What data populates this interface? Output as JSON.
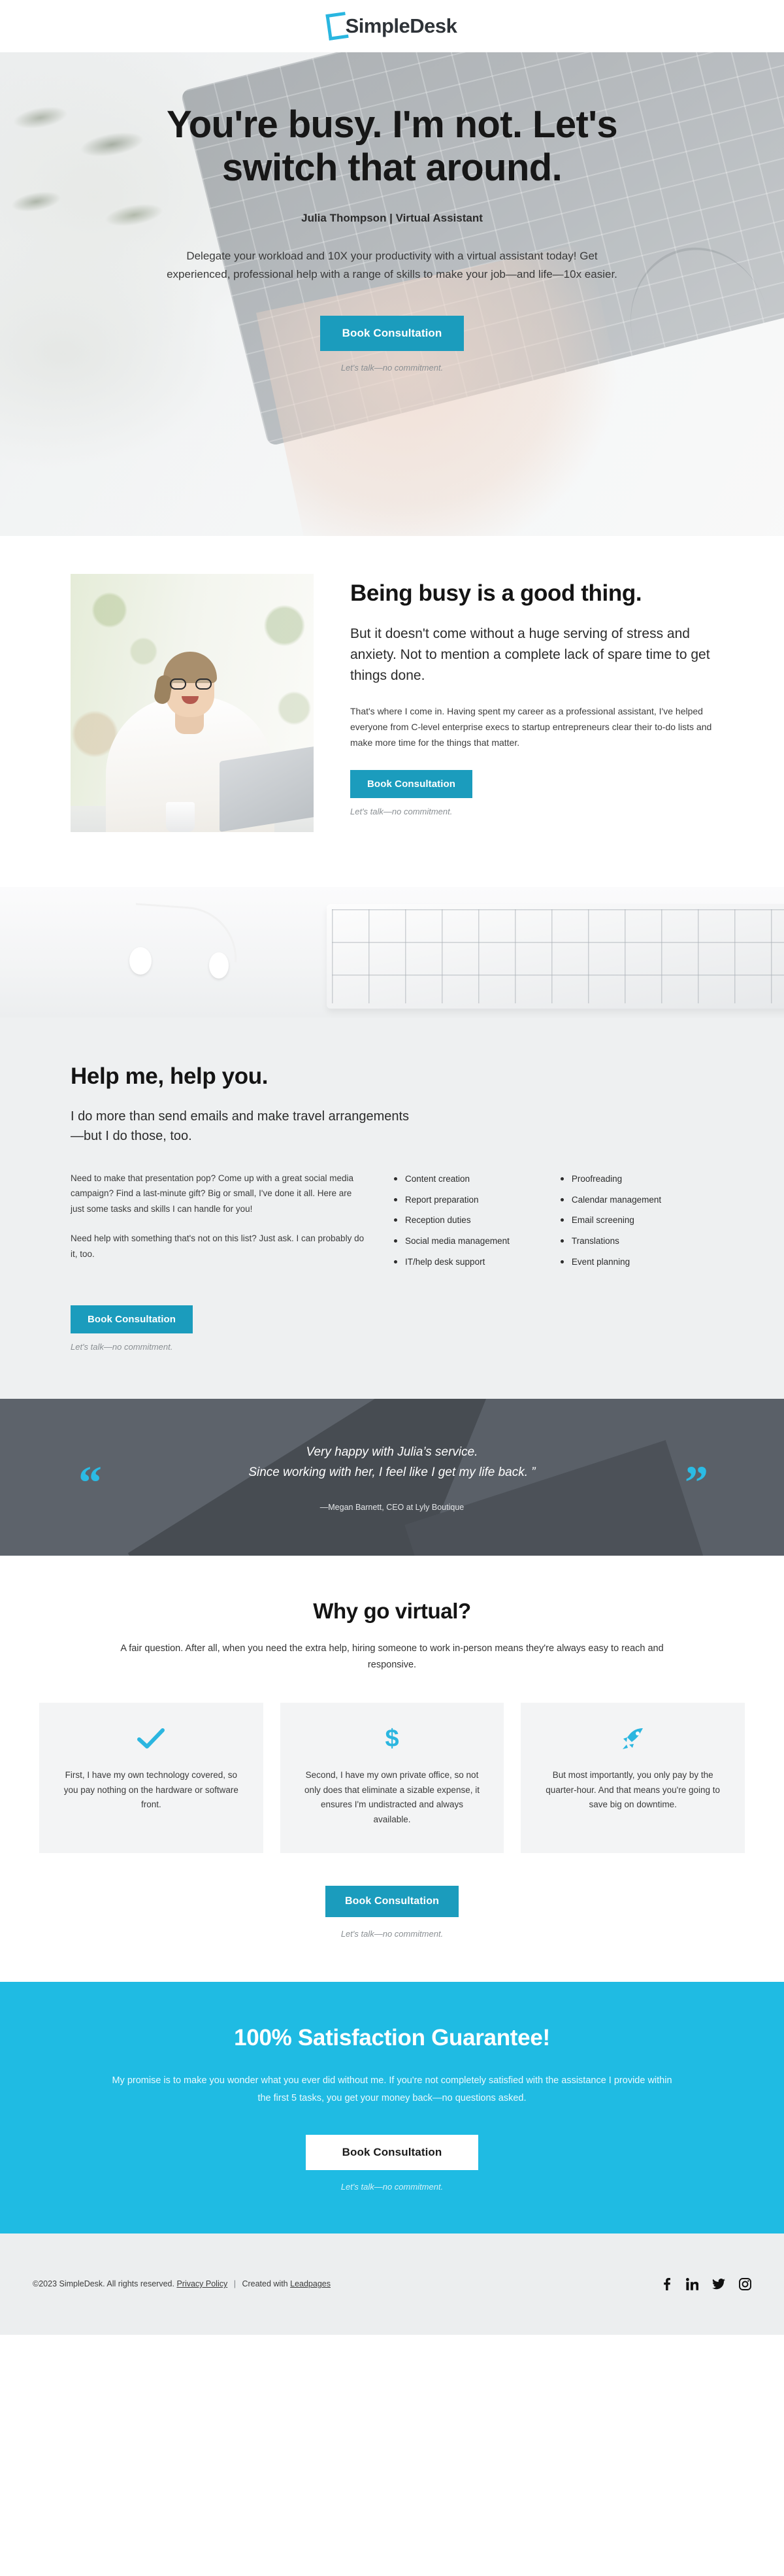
{
  "brand": {
    "name": "SimpleDesk",
    "accent_teal": "#1b9cbd",
    "accent_cyan": "#1fbbe3",
    "icon_mark": "bracket-mark"
  },
  "hero": {
    "headline": "You're busy. I'm not. Let's switch that around.",
    "role": "Julia Thompson | Virtual Assistant",
    "subtext": "Delegate your workload and 10X your productivity with a virtual assistant today! Get experienced, professional help with a range of skills to make your job—and life—10x easier.",
    "cta_label": "Book Consultation",
    "cta_note": "Let's talk—no commitment."
  },
  "busy": {
    "image_alt": "smiling-woman-with-glasses-at-laptop",
    "heading": "Being busy is a good thing.",
    "lead": "But it doesn't come without a huge serving of stress and anxiety. Not to mention a complete lack of spare time to get things done.",
    "body": "That's where I come in. Having spent my career as a professional assistant, I've helped everyone from C-level enterprise execs to startup entrepreneurs clear their to-do lists and make more time for the things that matter.",
    "cta_label": "Book Consultation",
    "cta_note": "Let's talk—no commitment."
  },
  "band": {
    "image_alt": "white-keyboard-and-earbuds"
  },
  "help": {
    "heading": "Help me, help you.",
    "lead": "I do more than send emails and make travel arrangements—but I do those, too.",
    "paragraphs": [
      "Need to make that presentation pop? Come up with a great social media campaign? Find a last-minute gift? Big or small, I've done it all. Here are just some tasks and skills I can handle for you!",
      "Need help with something that's not on this list? Just ask. I can probably do it, too."
    ],
    "skills_col1": [
      "Content creation",
      "Report preparation",
      "Reception duties",
      "Social media management",
      "IT/help desk support"
    ],
    "skills_col2": [
      "Proofreading",
      "Calendar management",
      "Email screening",
      "Translations",
      "Event planning"
    ],
    "cta_label": "Book Consultation",
    "cta_note": "Let's talk—no commitment."
  },
  "testimonial": {
    "line1": "Very happy with Julia’s service.",
    "line2": "Since working with her, I feel like I get my life back. ”",
    "attribution": "—Megan Barnett, CEO at Lyly Boutique",
    "quote_open": "“",
    "quote_close": "”"
  },
  "why": {
    "heading": "Why go virtual?",
    "subtext": "A fair question. After all, when you need the extra help, hiring someone to work in-person means they're always easy to reach and responsive.",
    "cards": [
      {
        "icon": "check-icon",
        "text": "First, I have my own technology covered, so you pay nothing on the hardware or software front."
      },
      {
        "icon": "dollar-icon",
        "glyph": "$",
        "text": "Second, I have my own private office, so not only does that eliminate a sizable expense, it ensures I'm undistracted and always available."
      },
      {
        "icon": "rocket-icon",
        "text": "But most importantly, you only pay by the quarter-hour. And that means you're going to save big on downtime."
      }
    ],
    "cta_label": "Book Consultation",
    "cta_note": "Let's talk—no commitment."
  },
  "guarantee": {
    "heading": "100% Satisfaction Guarantee!",
    "subtext": "My promise is to make you wonder what you ever did without me. If you're not completely satisfied with the assistance I provide within the first 5 tasks, you get your money back—no questions asked.",
    "cta_label": "Book Consultation",
    "cta_note": "Let's talk—no commitment."
  },
  "footer": {
    "copyright": "©2023 SimpleDesk. All rights reserved.",
    "privacy_label": "Privacy Policy",
    "separator": "|",
    "created_prefix": "Created with",
    "created_link": "Leadpages",
    "social": [
      "facebook-icon",
      "linkedin-icon",
      "twitter-icon",
      "instagram-icon"
    ]
  }
}
